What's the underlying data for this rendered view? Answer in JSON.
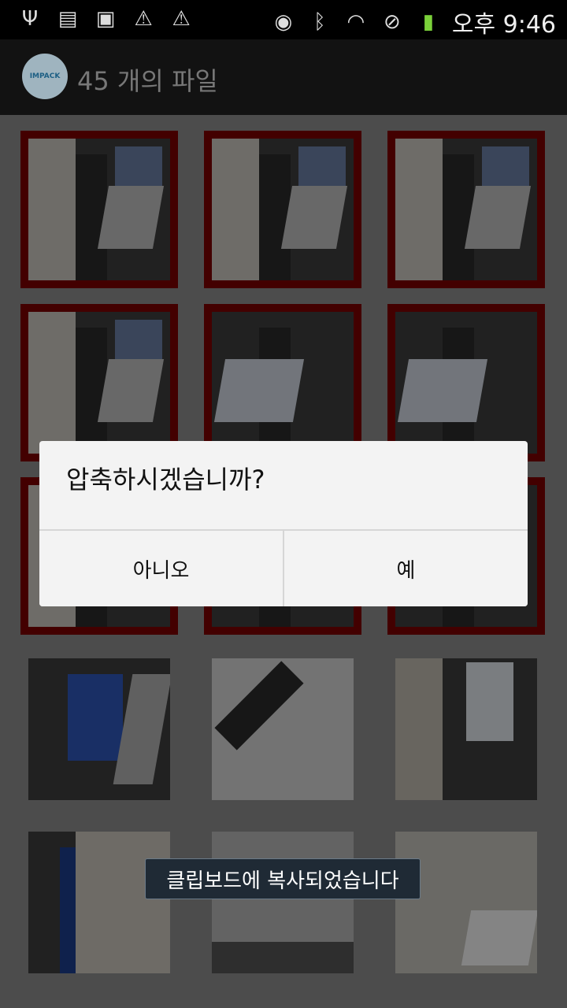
{
  "statusbar": {
    "time": "오후 9:46",
    "left_icons": [
      "usb-icon",
      "sim-off-icon",
      "image-icon",
      "warning-icon",
      "warning-icon"
    ],
    "right_icons": [
      "eye-icon",
      "bluetooth-icon",
      "wifi-icon",
      "do-not-disturb-icon",
      "battery-charging-icon"
    ]
  },
  "actionbar": {
    "logo_text": "IMPACK",
    "title": "45 개의 파일"
  },
  "grid": {
    "selected_count": 9
  },
  "dialog": {
    "title": "압축하시겠습니까?",
    "no_label": "아니오",
    "yes_label": "예"
  },
  "toast": {
    "text": "클립보드에 복사되었습니다"
  },
  "colors": {
    "selection_border": "#7a0000",
    "toast_bg": "#1f2a35"
  }
}
